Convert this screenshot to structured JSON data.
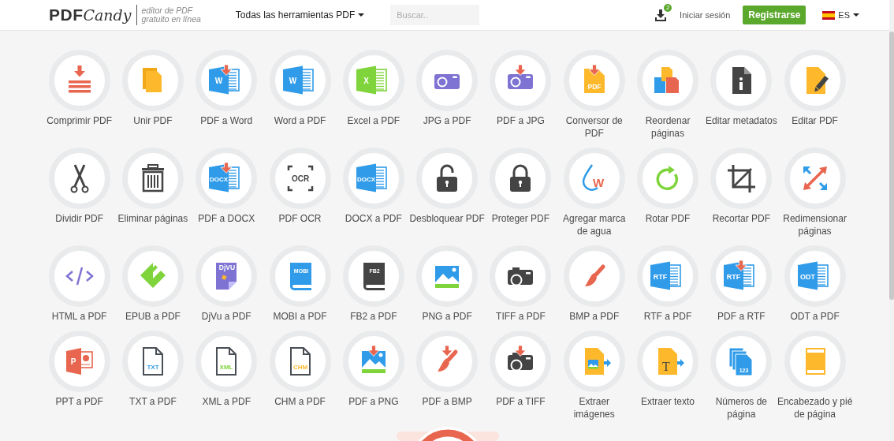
{
  "header": {
    "logo_prefix": "PDF",
    "logo_suffix": "Candy",
    "tagline": "editor de PDF\ngratuito en línea",
    "tools_menu": "Todas las herramientas PDF",
    "search": {
      "placeholder": "Buscar.."
    },
    "downloads_badge": "2",
    "login": "Iniciar sesión",
    "register": "Registrarse",
    "language": "ES"
  },
  "tools": [
    {
      "label": "Comprimir PDF",
      "kind": "compress",
      "arrow": false
    },
    {
      "label": "Unir PDF",
      "kind": "merge",
      "arrow": false
    },
    {
      "label": "PDF a Word",
      "kind": "doc",
      "icon_text": "W",
      "arrow": true
    },
    {
      "label": "Word a PDF",
      "kind": "doc",
      "icon_text": "W",
      "arrow": false
    },
    {
      "label": "Excel a PDF",
      "kind": "sheet",
      "icon_text": "X",
      "arrow": false
    },
    {
      "label": "JPG a PDF",
      "kind": "photo",
      "arrow": false
    },
    {
      "label": "PDF a JPG",
      "kind": "photo",
      "arrow": true
    },
    {
      "label": "Conversor de\nPDF",
      "kind": "pdffile",
      "icon_text": "PDF",
      "arrow": true
    },
    {
      "label": "Reordenar\npáginas",
      "kind": "reorder",
      "arrow": false
    },
    {
      "label": "Editar metadatos",
      "kind": "info",
      "arrow": false
    },
    {
      "label": "Editar PDF",
      "kind": "edit",
      "arrow": false
    },
    {
      "label": "Dividir PDF",
      "kind": "scissors",
      "arrow": false
    },
    {
      "label": "Eliminar páginas",
      "kind": "trash",
      "arrow": false
    },
    {
      "label": "PDF a DOCX",
      "kind": "doc",
      "icon_text": "DOCX",
      "arrow": true
    },
    {
      "label": "PDF OCR",
      "kind": "ocr",
      "icon_text": "OCR",
      "arrow": false
    },
    {
      "label": "DOCX a PDF",
      "kind": "doc",
      "icon_text": "DOCX",
      "arrow": false
    },
    {
      "label": "Desbloquear PDF",
      "kind": "unlock",
      "arrow": false
    },
    {
      "label": "Proteger PDF",
      "kind": "lock",
      "arrow": false
    },
    {
      "label": "Agregar marca\nde agua",
      "kind": "watermark",
      "icon_text": "W",
      "arrow": false
    },
    {
      "label": "Rotar PDF",
      "kind": "rotate",
      "arrow": false
    },
    {
      "label": "Recortar PDF",
      "kind": "crop",
      "arrow": false
    },
    {
      "label": "Redimensionar\npáginas",
      "kind": "resize",
      "arrow": false
    },
    {
      "label": "HTML a PDF",
      "kind": "code",
      "arrow": false
    },
    {
      "label": "EPUB a PDF",
      "kind": "epub",
      "arrow": false
    },
    {
      "label": "DjVu a PDF",
      "kind": "djvu",
      "icon_text": "DjVU",
      "arrow": false
    },
    {
      "label": "MOBI a PDF",
      "kind": "bluebook",
      "icon_text": "MOBI",
      "arrow": false
    },
    {
      "label": "FB2 a PDF",
      "kind": "darkbook",
      "icon_text": "FB2",
      "arrow": false
    },
    {
      "label": "PNG a PDF",
      "kind": "image",
      "arrow": false
    },
    {
      "label": "TIFF a PDF",
      "kind": "camera",
      "arrow": false
    },
    {
      "label": "BMP a PDF",
      "kind": "brush",
      "arrow": false
    },
    {
      "label": "RTF a PDF",
      "kind": "doc",
      "icon_text": "RTF",
      "arrow": false
    },
    {
      "label": "PDF a RTF",
      "kind": "doc",
      "icon_text": "RTF",
      "arrow": true
    },
    {
      "label": "ODT a PDF",
      "kind": "doc",
      "icon_text": "ODT",
      "arrow": false
    },
    {
      "label": "PPT a PDF",
      "kind": "slides",
      "icon_text": "P",
      "arrow": false
    },
    {
      "label": "TXT a PDF",
      "kind": "outline",
      "icon_text": "TXT",
      "color": "#2f9be9",
      "arrow": false
    },
    {
      "label": "XML a PDF",
      "kind": "outline",
      "icon_text": "XML",
      "color": "#7ed43a",
      "arrow": false
    },
    {
      "label": "CHM a PDF",
      "kind": "outline",
      "icon_text": "CHM",
      "color": "#fdb92b",
      "arrow": false
    },
    {
      "label": "PDF a PNG",
      "kind": "image",
      "arrow": true
    },
    {
      "label": "PDF a BMP",
      "kind": "brush",
      "arrow": true
    },
    {
      "label": "PDF a TIFF",
      "kind": "camera",
      "arrow": true
    },
    {
      "label": "Extraer\nimágenes",
      "kind": "extractimg",
      "arrow": false
    },
    {
      "label": "Extraer texto",
      "kind": "extracttext",
      "icon_text": "T",
      "arrow": false
    },
    {
      "label": "Números de\npágina",
      "kind": "numbers",
      "icon_text": "123",
      "arrow": false
    },
    {
      "label": "Encabezado y pié\nde página",
      "kind": "headerfooter",
      "arrow": false
    }
  ]
}
